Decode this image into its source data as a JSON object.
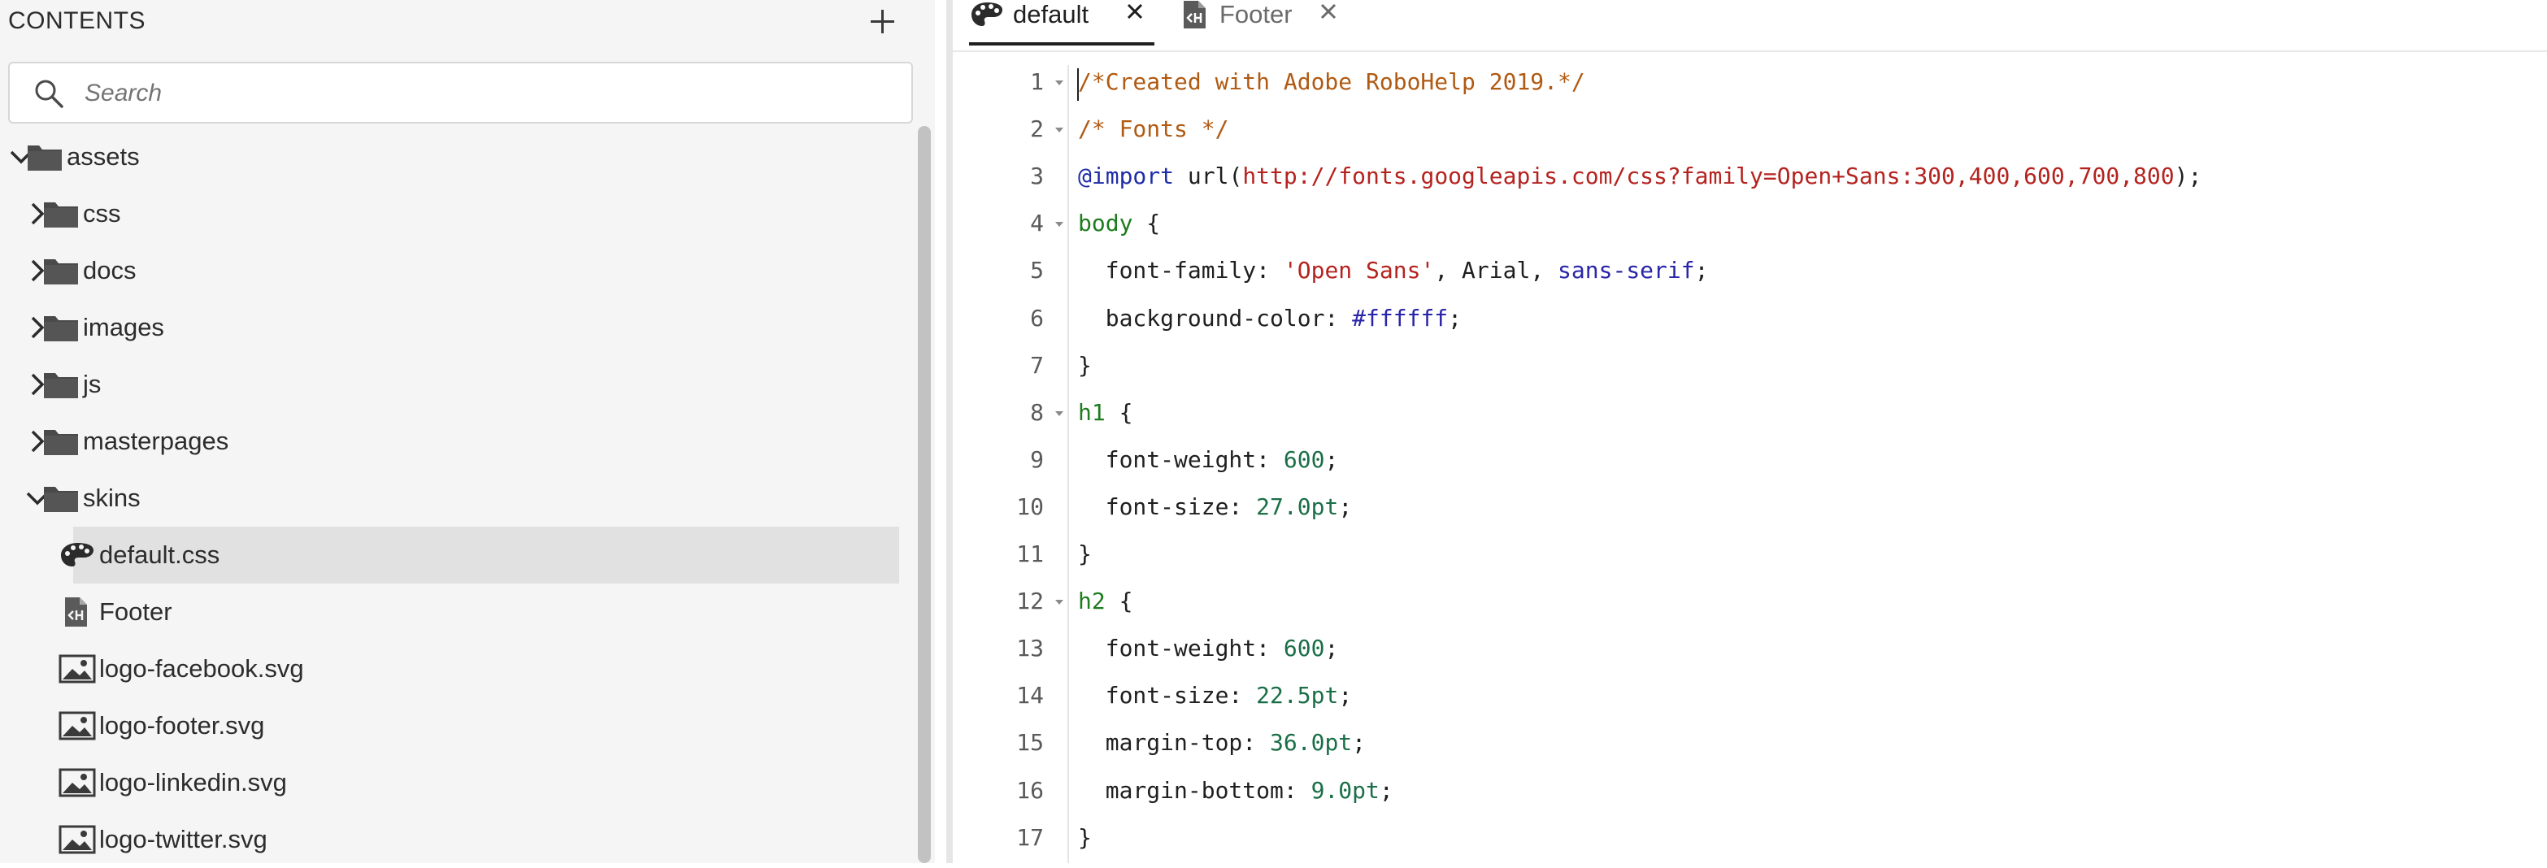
{
  "sidebar": {
    "title": "CONTENTS",
    "search_placeholder": "Search",
    "tree": [
      {
        "label": "assets",
        "type": "folder",
        "expanded": true,
        "depth": 0
      },
      {
        "label": "css",
        "type": "folder",
        "expanded": false,
        "depth": 1
      },
      {
        "label": "docs",
        "type": "folder",
        "expanded": false,
        "depth": 1
      },
      {
        "label": "images",
        "type": "folder",
        "expanded": false,
        "depth": 1
      },
      {
        "label": "js",
        "type": "folder",
        "expanded": false,
        "depth": 1
      },
      {
        "label": "masterpages",
        "type": "folder",
        "expanded": false,
        "depth": 1
      },
      {
        "label": "skins",
        "type": "folder",
        "expanded": true,
        "depth": 1
      },
      {
        "label": "default.css",
        "type": "skin",
        "depth": 2,
        "selected": true
      },
      {
        "label": "Footer",
        "type": "snippet",
        "depth": 2
      },
      {
        "label": "logo-facebook.svg",
        "type": "image",
        "depth": 2
      },
      {
        "label": "logo-footer.svg",
        "type": "image",
        "depth": 2
      },
      {
        "label": "logo-linkedin.svg",
        "type": "image",
        "depth": 2
      },
      {
        "label": "logo-twitter.svg",
        "type": "image",
        "depth": 2
      }
    ]
  },
  "editor": {
    "tabs": [
      {
        "label": "default",
        "icon": "palette-icon",
        "active": true
      },
      {
        "label": "Footer",
        "icon": "snippet-icon",
        "active": false
      }
    ],
    "lines": [
      {
        "n": "1",
        "fold": true,
        "tokens": [
          {
            "t": "/*Created with Adobe RoboHelp 2019.*/",
            "c": "comment"
          }
        ]
      },
      {
        "n": "2",
        "fold": true,
        "tokens": [
          {
            "t": "/* Fonts */",
            "c": "comment"
          }
        ]
      },
      {
        "n": "3",
        "fold": false,
        "tokens": [
          {
            "t": "@import",
            "c": "at"
          },
          {
            "t": " url(",
            "c": "plain"
          },
          {
            "t": "http://fonts.googleapis.com/css?family=Open+Sans:300,400,600,700,800",
            "c": "str"
          },
          {
            "t": ");",
            "c": "plain"
          }
        ]
      },
      {
        "n": "4",
        "fold": true,
        "tokens": [
          {
            "t": "body",
            "c": "sel"
          },
          {
            "t": " {",
            "c": "plain"
          }
        ]
      },
      {
        "n": "5",
        "fold": false,
        "tokens": [
          {
            "t": "  font-family: ",
            "c": "prop"
          },
          {
            "t": "'Open Sans'",
            "c": "str"
          },
          {
            "t": ", Arial, ",
            "c": "plain"
          },
          {
            "t": "sans-serif",
            "c": "kw"
          },
          {
            "t": ";",
            "c": "plain"
          }
        ]
      },
      {
        "n": "6",
        "fold": false,
        "tokens": [
          {
            "t": "  background-color: ",
            "c": "prop"
          },
          {
            "t": "#ffffff",
            "c": "hex"
          },
          {
            "t": ";",
            "c": "plain"
          }
        ]
      },
      {
        "n": "7",
        "fold": false,
        "tokens": [
          {
            "t": "}",
            "c": "plain"
          }
        ]
      },
      {
        "n": "8",
        "fold": true,
        "tokens": [
          {
            "t": "h1",
            "c": "sel"
          },
          {
            "t": " {",
            "c": "plain"
          }
        ]
      },
      {
        "n": "9",
        "fold": false,
        "tokens": [
          {
            "t": "  font-weight: ",
            "c": "prop"
          },
          {
            "t": "600",
            "c": "num"
          },
          {
            "t": ";",
            "c": "plain"
          }
        ]
      },
      {
        "n": "10",
        "fold": false,
        "tokens": [
          {
            "t": "  font-size: ",
            "c": "prop"
          },
          {
            "t": "27.0pt",
            "c": "num"
          },
          {
            "t": ";",
            "c": "plain"
          }
        ]
      },
      {
        "n": "11",
        "fold": false,
        "tokens": [
          {
            "t": "}",
            "c": "plain"
          }
        ]
      },
      {
        "n": "12",
        "fold": true,
        "tokens": [
          {
            "t": "h2",
            "c": "sel"
          },
          {
            "t": " {",
            "c": "plain"
          }
        ]
      },
      {
        "n": "13",
        "fold": false,
        "tokens": [
          {
            "t": "  font-weight: ",
            "c": "prop"
          },
          {
            "t": "600",
            "c": "num"
          },
          {
            "t": ";",
            "c": "plain"
          }
        ]
      },
      {
        "n": "14",
        "fold": false,
        "tokens": [
          {
            "t": "  font-size: ",
            "c": "prop"
          },
          {
            "t": "22.5pt",
            "c": "num"
          },
          {
            "t": ";",
            "c": "plain"
          }
        ]
      },
      {
        "n": "15",
        "fold": false,
        "tokens": [
          {
            "t": "  margin-top: ",
            "c": "prop"
          },
          {
            "t": "36.0pt",
            "c": "num"
          },
          {
            "t": ";",
            "c": "plain"
          }
        ]
      },
      {
        "n": "16",
        "fold": false,
        "tokens": [
          {
            "t": "  margin-bottom: ",
            "c": "prop"
          },
          {
            "t": "9.0pt",
            "c": "num"
          },
          {
            "t": ";",
            "c": "plain"
          }
        ]
      },
      {
        "n": "17",
        "fold": false,
        "tokens": [
          {
            "t": "}",
            "c": "plain"
          }
        ]
      }
    ]
  },
  "colors": {
    "sidebar_bg": "#f5f5f5",
    "selected_row": "#e1e1e1",
    "comment": "#b05a12",
    "string": "#b5231f",
    "selector": "#1d7c1d",
    "number": "#1a6f47",
    "keyword": "#2a26a8"
  }
}
